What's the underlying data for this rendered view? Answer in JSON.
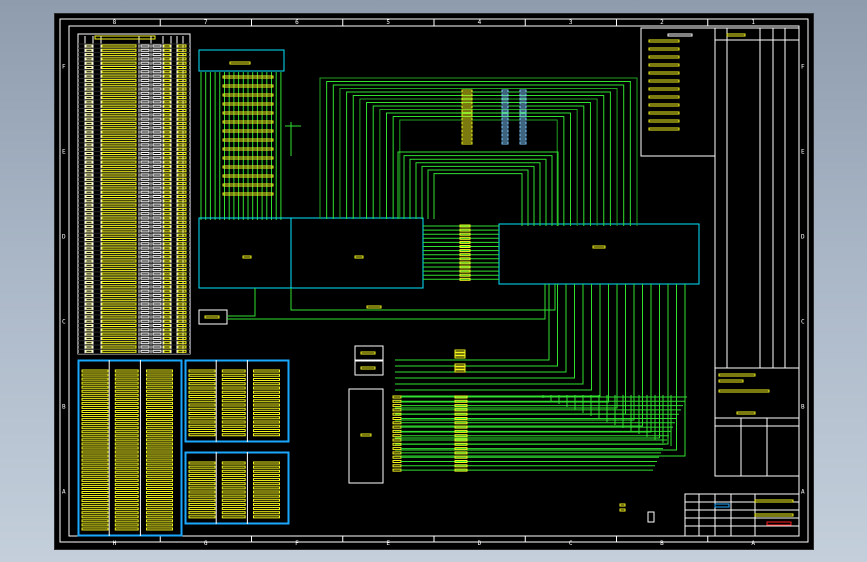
{
  "colors": {
    "background": "#000000",
    "frame": "#ffffff",
    "wire": "#2fe02f",
    "wire_dark": "#1fa01f",
    "box": "#00e5ff",
    "text_yellow": "#f5f51e",
    "highlight_blue": "#1aa8ff"
  },
  "sheet": {
    "column_markers": [
      "H",
      "G",
      "F",
      "E",
      "D",
      "C",
      "B",
      "A"
    ],
    "top_markers": [
      "8",
      "7",
      "6",
      "5",
      "4",
      "3",
      "2",
      "1"
    ],
    "row_markers": [
      "F",
      "E",
      "D",
      "C",
      "B",
      "A"
    ]
  },
  "blocks": [
    {
      "id": "left-module"
    },
    {
      "id": "center-module"
    },
    {
      "id": "right-module"
    },
    {
      "id": "connector-box"
    },
    {
      "id": "small-box-1"
    },
    {
      "id": "small-box-2"
    },
    {
      "id": "small-box-3"
    }
  ]
}
